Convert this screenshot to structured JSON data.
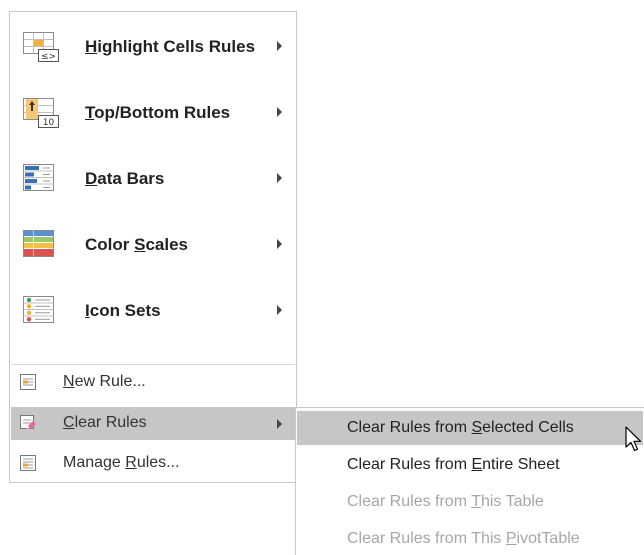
{
  "menu": {
    "big_items": [
      {
        "pre": "",
        "mn": "H",
        "post": "ighlight Cells Rules",
        "icon": "highlight-cells-icon",
        "has_submenu": true
      },
      {
        "pre": "",
        "mn": "T",
        "post": "op/Bottom Rules",
        "icon": "top-bottom-icon",
        "has_submenu": true
      },
      {
        "pre": "",
        "mn": "D",
        "post": "ata Bars",
        "icon": "data-bars-icon",
        "has_submenu": true
      },
      {
        "pre": "Color ",
        "mn": "S",
        "post": "cales",
        "icon": "color-scales-icon",
        "has_submenu": true
      },
      {
        "pre": "",
        "mn": "I",
        "post": "con Sets",
        "icon": "icon-sets-icon",
        "has_submenu": true
      }
    ],
    "small_items": [
      {
        "pre": "",
        "mn": "N",
        "post": "ew Rule...",
        "icon": "new-rule-icon",
        "active": false
      },
      {
        "pre": "",
        "mn": "C",
        "post": "lear Rules",
        "icon": "clear-rules-icon",
        "active": true,
        "has_submenu": true
      },
      {
        "pre": "Manage ",
        "mn": "R",
        "post": "ules...",
        "icon": "manage-rules-icon",
        "active": false
      }
    ],
    "icon_text": {
      "highlight_badge": "≤>",
      "top_badge": "10"
    }
  },
  "submenu": {
    "items": [
      {
        "pre": "Clear Rules from ",
        "mn": "S",
        "post": "elected Cells",
        "state": "hover"
      },
      {
        "pre": "Clear Rules from ",
        "mn": "E",
        "post": "ntire Sheet",
        "state": "enabled"
      },
      {
        "pre": "Clear Rules from ",
        "mn": "T",
        "post": "his Table",
        "state": "disabled"
      },
      {
        "pre": "Clear Rules from This ",
        "mn": "P",
        "post": "ivotTable",
        "state": "disabled"
      }
    ]
  },
  "colors": {
    "hover_bg": "#c6c6c6",
    "disabled_text": "#a6a6a6",
    "border": "#c8c8c8"
  }
}
